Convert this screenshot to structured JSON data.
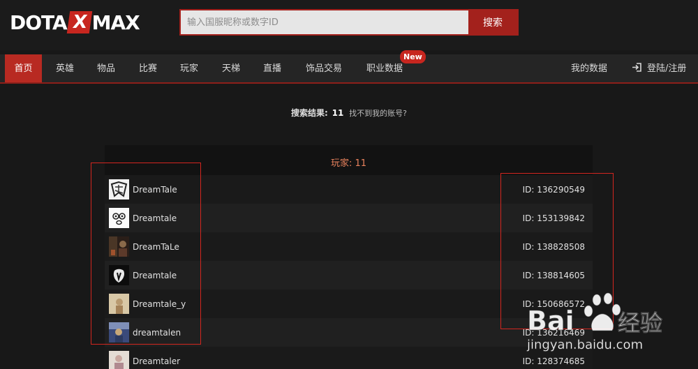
{
  "header": {
    "logo_left": "DOTA",
    "logo_mark": "X",
    "logo_right": "MAX",
    "search_placeholder": "输入国服昵称或数字ID",
    "search_button": "搜索"
  },
  "nav": {
    "items": [
      "首页",
      "英雄",
      "物品",
      "比赛",
      "玩家",
      "天梯",
      "直播",
      "饰品交易",
      "职业数据"
    ],
    "active_index": 0,
    "new_badge": "New",
    "my_data": "我的数据",
    "login": "登陆/注册"
  },
  "results": {
    "label": "搜索结果:",
    "count": "11",
    "help_link": "找不到我的账号?",
    "panel_title": "玩家: 11",
    "players": [
      {
        "name": "DreamTale",
        "id": "ID: 136290549",
        "avatar": "ornate-emblem-icon"
      },
      {
        "name": "Dreamtale",
        "id": "ID: 153139842",
        "avatar": "face-icon"
      },
      {
        "name": "DreamTaLe",
        "id": "ID: 138828508",
        "avatar": "dark-scene-icon"
      },
      {
        "name": "Dreamtale",
        "id": "ID: 138814605",
        "avatar": "black-white-silhouette-icon"
      },
      {
        "name": "Dreamtale_y",
        "id": "ID: 150686572",
        "avatar": "sepia-figure-icon"
      },
      {
        "name": "dreamtalen",
        "id": "ID: 136216469",
        "avatar": "blue-figure-icon"
      },
      {
        "name": "Dreamtaler",
        "id": "ID: 128374685",
        "avatar": "pale-figure-icon"
      }
    ]
  },
  "watermark": {
    "brand_left": "Bai",
    "brand_right": "经验",
    "url": "jingyan.baidu.com"
  },
  "colors": {
    "accent": "#c7261f",
    "nav_active": "#b82a22",
    "panel_title": "#e9825d",
    "annotation": "#d4261f"
  }
}
